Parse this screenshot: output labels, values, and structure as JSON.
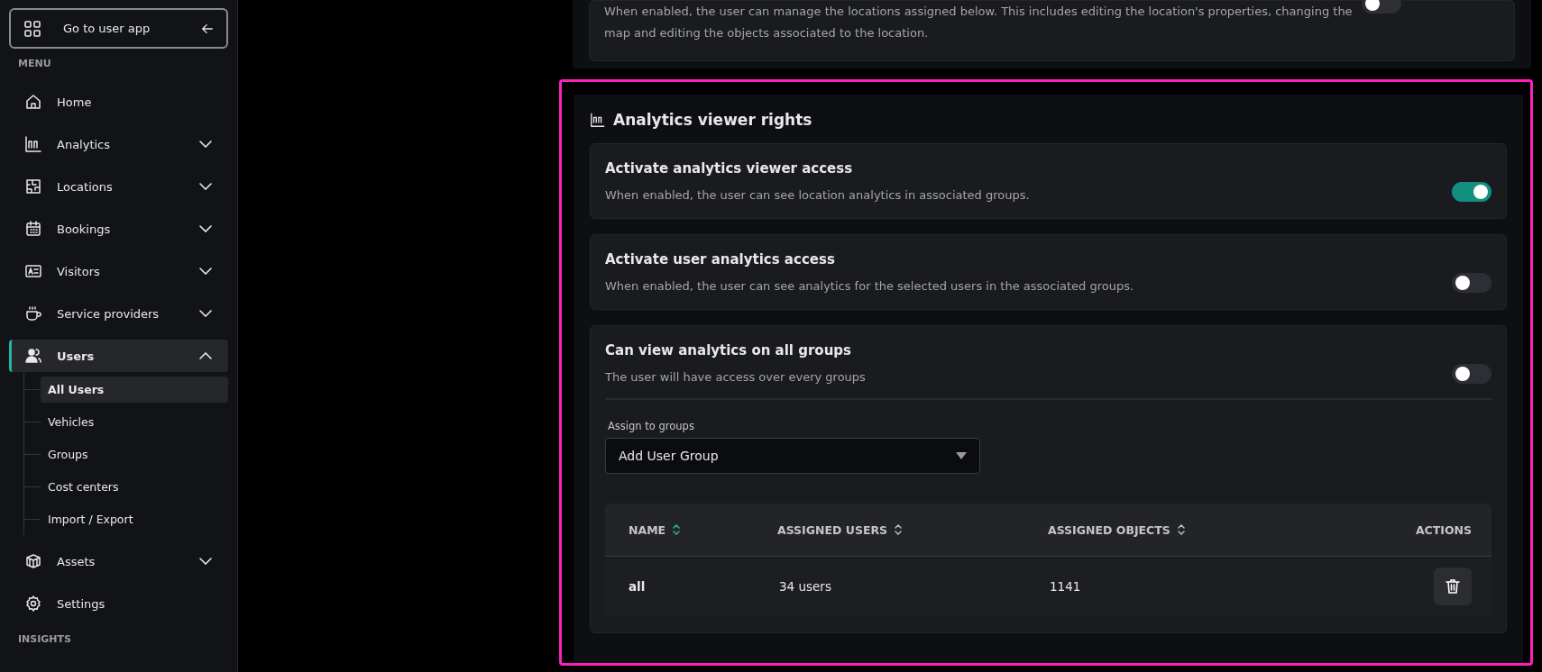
{
  "sidebar": {
    "back_button": "Go to user app",
    "menu_heading": "MENU",
    "items": [
      {
        "label": "Home",
        "kind": "link",
        "selected": false
      },
      {
        "label": "Analytics",
        "kind": "group",
        "expanded": false,
        "selected": false
      },
      {
        "label": "Locations",
        "kind": "group",
        "expanded": false,
        "selected": false
      },
      {
        "label": "Bookings",
        "kind": "group",
        "expanded": false,
        "selected": false
      },
      {
        "label": "Visitors",
        "kind": "group",
        "expanded": false,
        "selected": false
      },
      {
        "label": "Service providers",
        "kind": "group",
        "expanded": false,
        "selected": false
      },
      {
        "label": "Users",
        "kind": "group",
        "expanded": true,
        "selected": true,
        "children": [
          {
            "label": "All Users",
            "selected": true
          },
          {
            "label": "Vehicles",
            "selected": false
          },
          {
            "label": "Groups",
            "selected": false
          },
          {
            "label": "Cost centers",
            "selected": false
          },
          {
            "label": "Import / Export",
            "selected": false
          }
        ]
      },
      {
        "label": "Assets",
        "kind": "group",
        "expanded": false,
        "selected": false
      },
      {
        "label": "Settings",
        "kind": "link",
        "selected": false
      }
    ],
    "insights_heading": "INSIGHTS"
  },
  "top_card": {
    "description": "When enabled, the user can manage the locations assigned below. This includes editing the location's properties, changing the map and editing the objects associated to the location.",
    "on": false
  },
  "section": {
    "title": "Analytics viewer rights",
    "settings": [
      {
        "title": "Activate analytics viewer access",
        "description": "When enabled, the user can see location analytics in associated groups.",
        "on": true
      },
      {
        "title": "Activate user analytics access",
        "description": "When enabled, the user can see analytics for the selected users in the associated groups.",
        "on": false
      },
      {
        "title": "Can view analytics on all groups",
        "description": "The user will have access over every groups",
        "on": false,
        "group_picker": {
          "label": "Assign to groups",
          "placeholder": "Add User Group"
        },
        "table": {
          "columns": [
            {
              "label": "NAME",
              "kind": "sortable",
              "sort_active": true
            },
            {
              "label": "ASSIGNED USERS",
              "kind": "sortable",
              "sort_active": false
            },
            {
              "label": "ASSIGNED OBJECTS",
              "kind": "sortable",
              "sort_active": false
            },
            {
              "label": "ACTIONS",
              "kind": "plain"
            }
          ],
          "rows": [
            {
              "name": "all",
              "assigned_users": "34 users",
              "assigned_objects": "1141"
            }
          ]
        }
      }
    ]
  }
}
